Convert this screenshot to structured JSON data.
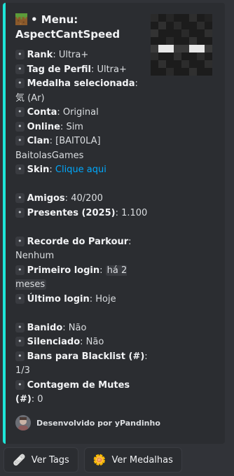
{
  "embed": {
    "accent_color": "#1ee5d8",
    "title_icon": "grass-block-icon",
    "title_line1": "• Menu:",
    "title_line2": "AspectCantSpeed",
    "thumbnail": "enderman-skin-head",
    "fields": [
      {
        "label": "Rank",
        "value": "Ultra+"
      },
      {
        "label": "Tag de Perfil",
        "value": "Ultra+"
      },
      {
        "label": "Medalha selecionada",
        "value": "気 (Ar)"
      },
      {
        "label": "Conta",
        "value": "Original"
      },
      {
        "label": "Online",
        "value": "Sim"
      },
      {
        "label": "Clan",
        "value": "[BAIT0LA] BaitolasGames"
      },
      {
        "label": "Skin",
        "value": "Clique aqui"
      },
      {
        "label": "Amigos",
        "value": "40/200"
      },
      {
        "label": "Presentes (2025)",
        "value": "1.100"
      },
      {
        "label": "Recorde do Parkour",
        "value": "Nenhum"
      },
      {
        "label": "Primeiro login",
        "value": "há 2 meses"
      },
      {
        "label": "Último login",
        "value": "Hoje"
      },
      {
        "label": "Banido",
        "value": "Não"
      },
      {
        "label": "Silenciado",
        "value": "Não"
      },
      {
        "label": "Bans para Blacklist (#)",
        "value": "1/3"
      },
      {
        "label": "Contagem de Mutes (#)",
        "value": "0"
      }
    ],
    "bullet": "•",
    "footer_text": "Desenvolvido por yPandinho"
  },
  "buttons": [
    {
      "label": "Ver Tags",
      "icon": "bandage-icon",
      "glyph": "🩹"
    },
    {
      "label": "Ver Medalhas",
      "icon": "medal-icon",
      "glyph": "🌼"
    }
  ]
}
